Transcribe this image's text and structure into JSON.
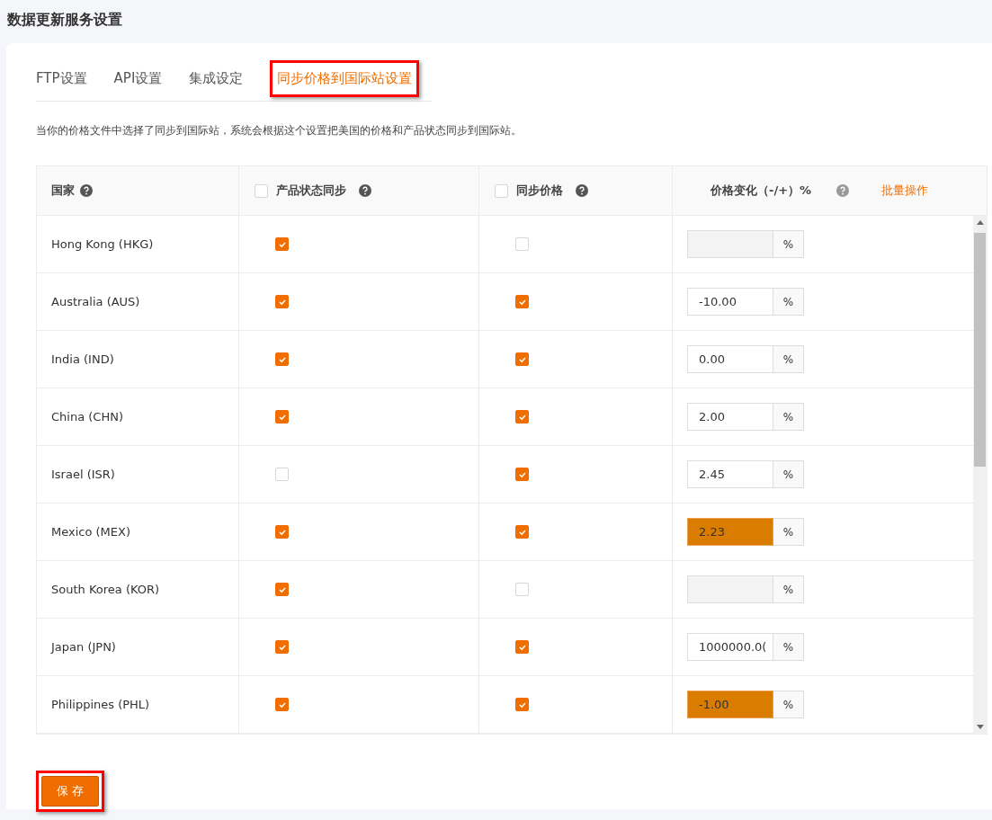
{
  "page_title": "数据更新服务设置",
  "tabs": [
    {
      "label": "FTP设置",
      "selected": false,
      "highlighted": false
    },
    {
      "label": "API设置",
      "selected": false,
      "highlighted": false
    },
    {
      "label": "集成设定",
      "selected": false,
      "highlighted": false
    },
    {
      "label": "同步价格到国际站设置",
      "selected": true,
      "highlighted": true
    }
  ],
  "description": "当你的价格文件中选择了同步到国际站，系统会根据这个设置把美国的价格和产品状态同步到国际站。",
  "table": {
    "columns": [
      {
        "label": "国家"
      },
      {
        "label": "产品状态同步",
        "checked": false
      },
      {
        "label": "同步价格",
        "checked": false
      },
      {
        "label": "价格变化（-/+）%"
      }
    ],
    "bulk_action": "批量操作",
    "rows": [
      {
        "country": "Hong Kong (HKG)",
        "status_sync": true,
        "price_sync": false,
        "price_change": {
          "unit": "%",
          "highlighted": false
        }
      },
      {
        "country": "Australia (AUS)",
        "status_sync": true,
        "price_sync": true,
        "price_change": {
          "value": "-10.00",
          "unit": "%",
          "highlighted": false
        }
      },
      {
        "country": "India (IND)",
        "status_sync": true,
        "price_sync": true,
        "price_change": {
          "value": "0.00",
          "unit": "%",
          "highlighted": false
        }
      },
      {
        "country": "China (CHN)",
        "status_sync": true,
        "price_sync": true,
        "price_change": {
          "value": "2.00",
          "unit": "%",
          "highlighted": false
        }
      },
      {
        "country": "Israel (ISR)",
        "status_sync": false,
        "price_sync": true,
        "price_change": {
          "value": "2.45",
          "unit": "%",
          "highlighted": false
        }
      },
      {
        "country": "Mexico (MEX)",
        "status_sync": true,
        "price_sync": true,
        "price_change": {
          "value": "2.23",
          "unit": "%",
          "highlighted": true
        }
      },
      {
        "country": "South Korea (KOR)",
        "status_sync": true,
        "price_sync": false,
        "price_change": {
          "unit": "%",
          "highlighted": false
        }
      },
      {
        "country": "Japan (JPN)",
        "status_sync": true,
        "price_sync": true,
        "price_change": {
          "value": "1000000.0(",
          "unit": "%",
          "highlighted": false
        }
      },
      {
        "country": "Philippines (PHL)",
        "status_sync": true,
        "price_sync": true,
        "price_change": {
          "value": "-1.00",
          "unit": "%",
          "highlighted": true
        }
      }
    ]
  },
  "save_button": {
    "label": "保 存",
    "highlighted": true
  }
}
